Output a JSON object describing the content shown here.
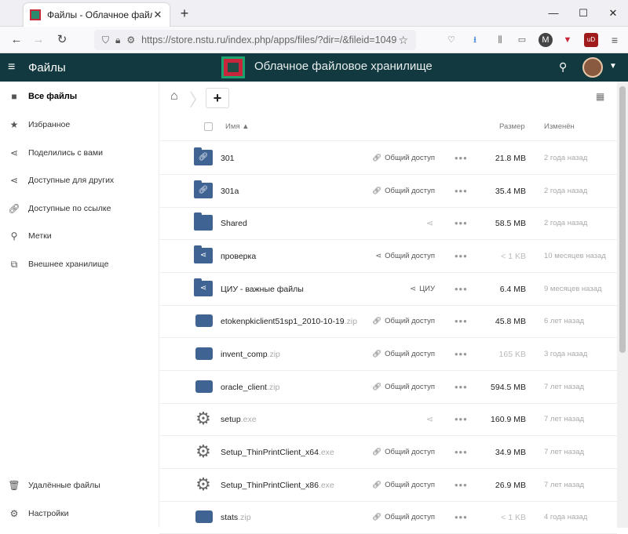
{
  "browser": {
    "tab_title": "Файлы - Облачное файловое",
    "url": "https://store.nstu.ru/index.php/apps/files/?dir=/&fileid=1049"
  },
  "header": {
    "app_name": "Файлы",
    "site_title": "Облачное файловое хранилище"
  },
  "sidebar": {
    "items": [
      {
        "label": "Все файлы",
        "icon": "folder-icon"
      },
      {
        "label": "Избранное",
        "icon": "star-icon"
      },
      {
        "label": "Поделились с вами",
        "icon": "share-icon"
      },
      {
        "label": "Доступные для других",
        "icon": "share-icon"
      },
      {
        "label": "Доступные по ссылке",
        "icon": "link-icon"
      },
      {
        "label": "Метки",
        "icon": "search-icon"
      },
      {
        "label": "Внешнее хранилище",
        "icon": "external-icon"
      }
    ],
    "bottom": [
      {
        "label": "Удалённые файлы",
        "icon": "trash-icon"
      },
      {
        "label": "Настройки",
        "icon": "gear-icon"
      }
    ]
  },
  "table": {
    "col_name": "Имя",
    "col_size": "Размер",
    "col_modified": "Изменён",
    "rows": [
      {
        "name": "301",
        "ext": "",
        "type": "folder-link",
        "share": "Общий доступ",
        "share_icon": "link",
        "size": "21.8 MB",
        "modified": "2 года назад"
      },
      {
        "name": "301a",
        "ext": "",
        "type": "folder-link",
        "share": "Общий доступ",
        "share_icon": "link",
        "size": "35.4 MB",
        "modified": "2 года назад"
      },
      {
        "name": "Shared",
        "ext": "",
        "type": "folder",
        "share": "",
        "share_icon": "share-faded",
        "size": "58.5 MB",
        "modified": "2 года назад"
      },
      {
        "name": "проверка",
        "ext": "",
        "type": "folder-share",
        "share": "Общий доступ",
        "share_icon": "share",
        "size": "< 1 KB",
        "size_light": true,
        "modified": "10 месяцев назад"
      },
      {
        "name": "ЦИУ - важные файлы",
        "ext": "",
        "type": "folder-share",
        "share": "ЦИУ",
        "share_icon": "share",
        "size": "6.4 MB",
        "modified": "9 месяцев назад"
      },
      {
        "name": "etokenpkiclient51sp1_2010-10-19",
        "ext": ".zip",
        "type": "zip",
        "share": "Общий доступ",
        "share_icon": "link",
        "size": "45.8 MB",
        "modified": "6 лет назад"
      },
      {
        "name": "invent_comp",
        "ext": ".zip",
        "type": "zip",
        "share": "Общий доступ",
        "share_icon": "link",
        "size": "165 KB",
        "size_light": true,
        "modified": "3 года назад"
      },
      {
        "name": "oracle_client",
        "ext": ".zip",
        "type": "zip",
        "share": "Общий доступ",
        "share_icon": "link",
        "size": "594.5 MB",
        "modified": "7 лет назад"
      },
      {
        "name": "setup",
        "ext": ".exe",
        "type": "exe",
        "share": "",
        "share_icon": "share-faded",
        "size": "160.9 MB",
        "modified": "7 лет назад"
      },
      {
        "name": "Setup_ThinPrintClient_x64",
        "ext": ".exe",
        "type": "exe",
        "share": "Общий доступ",
        "share_icon": "link",
        "size": "34.9 MB",
        "modified": "7 лет назад"
      },
      {
        "name": "Setup_ThinPrintClient_x86",
        "ext": ".exe",
        "type": "exe",
        "share": "Общий доступ",
        "share_icon": "link",
        "size": "26.9 MB",
        "modified": "7 лет назад"
      },
      {
        "name": "stats",
        "ext": ".zip",
        "type": "zip",
        "share": "Общий доступ",
        "share_icon": "link",
        "size": "< 1 KB",
        "size_light": true,
        "modified": "4 года назад"
      }
    ]
  }
}
